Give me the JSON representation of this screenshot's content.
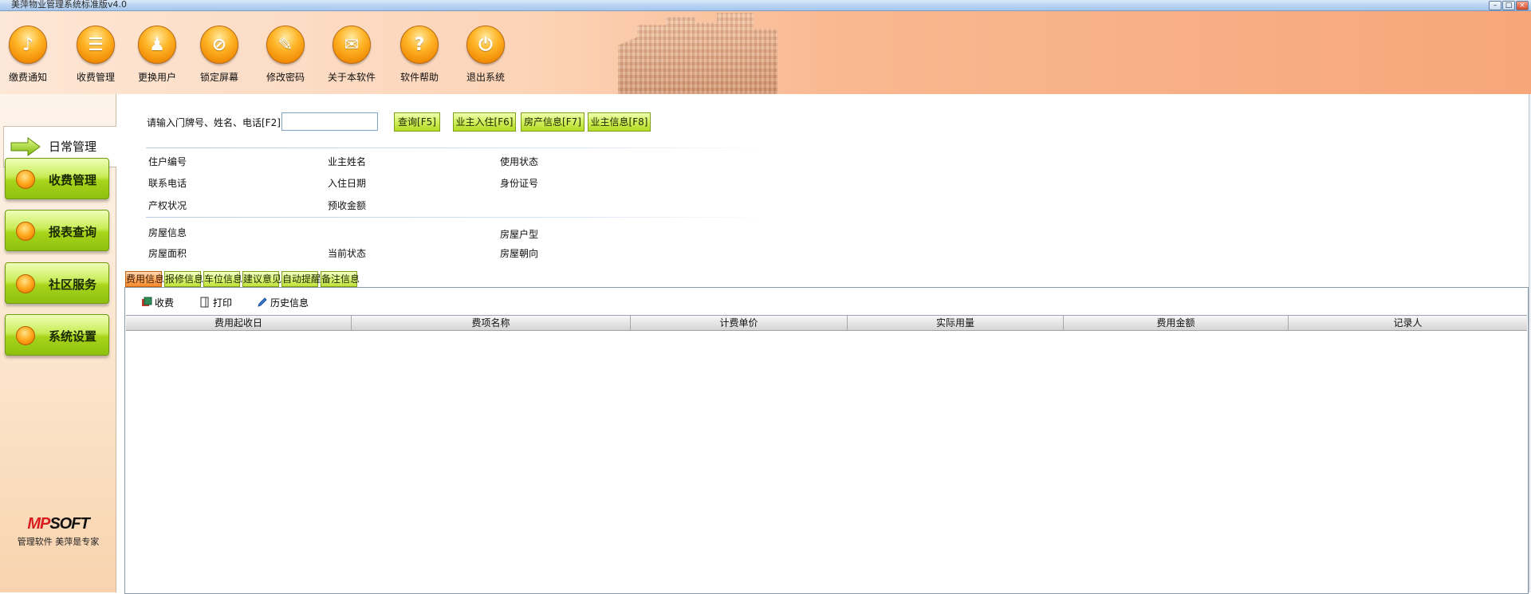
{
  "window": {
    "title": "美萍物业管理系统标准版v4.0",
    "min": "–",
    "max": "□",
    "close": "×"
  },
  "toolbar": [
    {
      "label": "缴费通知",
      "icon": "bell-notice-icon",
      "glyph": "♪"
    },
    {
      "label": "收费管理",
      "icon": "ledger-icon",
      "glyph": "☰"
    },
    {
      "label": "更换用户",
      "icon": "user-switch-icon",
      "glyph": "♟"
    },
    {
      "label": "锁定屏幕",
      "icon": "lock-screen-icon",
      "glyph": "⊘"
    },
    {
      "label": "修改密码",
      "icon": "key-icon",
      "glyph": "✎"
    },
    {
      "label": "关于本软件",
      "icon": "about-icon",
      "glyph": "✉"
    },
    {
      "label": "软件帮助",
      "icon": "help-icon",
      "glyph": "?"
    },
    {
      "label": "退出系统",
      "icon": "power-icon",
      "glyph": "⏻"
    }
  ],
  "sidebar": {
    "active": "日常管理",
    "items": [
      "收费管理",
      "报表查询",
      "社区服务",
      "系统设置"
    ]
  },
  "logo": {
    "brand_m": "MP",
    "brand_rest": "SOFT",
    "slogan": "管理软件  美萍是专家"
  },
  "search": {
    "label": "请输入门牌号、姓名、电话[F2]",
    "value": "",
    "query_btn": "查询[F5]",
    "actions": [
      "业主入住[F6]",
      "房产信息[F7]",
      "业主信息[F8]"
    ]
  },
  "owner_fields": {
    "room_no": "住户编号",
    "owner_name": "业主姓名",
    "use_status": "使用状态",
    "phone": "联系电话",
    "move_in_date": "入住日期",
    "id_no": "身份证号",
    "ownership": "产权状况",
    "prepaid": "预收金额"
  },
  "house_fields": {
    "house_info": "房屋信息",
    "house_type": "房屋户型",
    "area": "房屋面积",
    "current_status": "当前状态",
    "orientation": "房屋朝向"
  },
  "tabs": [
    "费用信息",
    "报修信息",
    "车位信息",
    "建议意见",
    "自动提醒",
    "备注信息"
  ],
  "fee_toolbar": {
    "charge": "收费",
    "print": "打印",
    "history": "历史信息"
  },
  "fee_table": {
    "columns": [
      "费用起收日",
      "费项名称",
      "计费单价",
      "实际用量",
      "费用金额",
      "记录人"
    ],
    "rows": []
  }
}
